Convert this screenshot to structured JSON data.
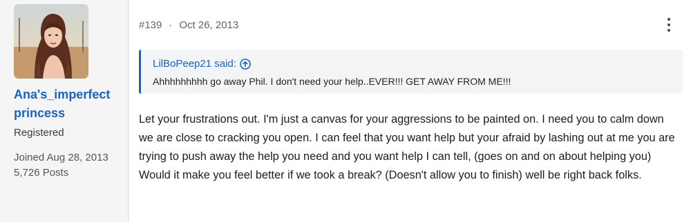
{
  "user": {
    "name": "Ana's_imperfect princess",
    "title": "Registered",
    "joined": "Joined Aug 28, 2013",
    "posts": "5,726 Posts"
  },
  "post": {
    "number": "#139",
    "separator": "·",
    "date": "Oct 26, 2013",
    "quote": {
      "author_line": "LilBoPeep21 said:",
      "text": "Ahhhhhhhhh go away Phil. I don't need your help..EVER!!! GET AWAY FROM ME!!!"
    },
    "body": "Let your frustrations out. I'm just a canvas for your aggressions to be painted on. I need you to calm down we are close to cracking you open. I can feel that you want help but your afraid by lashing out at me you are trying to push away the help you need and you want help I can tell, (goes on and on about helping you) Would it make you feel better if we took a break? (Doesn't allow you to finish) well be right back folks."
  },
  "colors": {
    "accent": "#1862c4",
    "sidebar_bg": "#f5f5f5",
    "quote_bg": "#f3f4f6"
  }
}
